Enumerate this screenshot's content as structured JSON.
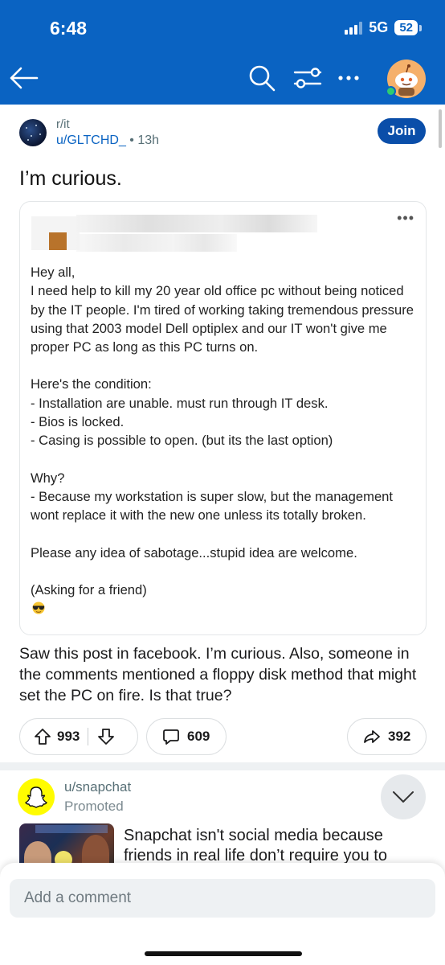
{
  "status_bar": {
    "time": "6:48",
    "network": "5G",
    "battery": "52"
  },
  "header": {
    "icons": [
      "back-arrow-icon",
      "search-icon",
      "filter-sliders-icon",
      "more-icon",
      "user-avatar-icon"
    ],
    "colors": {
      "background": "#0a63c2"
    }
  },
  "post": {
    "subreddit": "r/it",
    "author": "u/GLTCHD_",
    "separator": "•",
    "age": "13h",
    "join_label": "Join",
    "title": "I’m curious.",
    "embedded_post": {
      "more_label": "•••",
      "paragraphs": [
        "Hey all,\nI need help to kill my 20 year old office pc without being noticed by the IT people. I'm tired of working taking tremendous pressure using that 2003 model Dell optiplex and our IT won't give me proper PC as long as this PC turns on.",
        "Here's the condition:\n- Installation are unable. must run through IT desk.\n- Bios is locked.\n- Casing is possible to open. (but its the last option)",
        "Why?\n- Because my workstation is super slow, but the management wont replace it with the new one unless its totally broken.",
        "Please any idea of sabotage...stupid idea are welcome."
      ],
      "closing": "(Asking for a friend)"
    },
    "body": "Saw this post in facebook. I’m curious. Also, someone in the comments mentioned a floppy disk method that might set the PC on fire. Is that true?",
    "upvotes": "993",
    "comments": "609",
    "shares": "392"
  },
  "promoted": {
    "user": "u/snapchat",
    "label": "Promoted",
    "text": "Snapchat isn't social media because friends in real life don’t require you to",
    "colors": {
      "avatar_bg": "#fffc00"
    }
  },
  "comment_bar": {
    "placeholder": "Add a comment"
  }
}
